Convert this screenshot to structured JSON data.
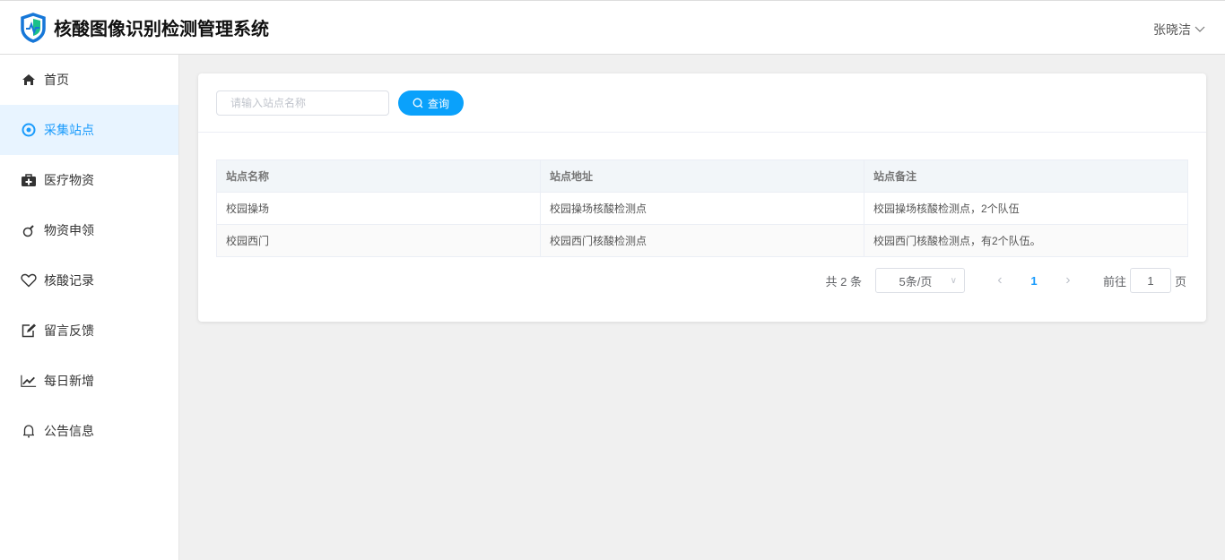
{
  "app": {
    "title": "核酸图像识别检测管理系统",
    "user": "张晓洁"
  },
  "sidebar": {
    "items": [
      {
        "label": "首页",
        "icon": "home-icon"
      },
      {
        "label": "采集站点",
        "icon": "target-icon",
        "active": true
      },
      {
        "label": "医疗物资",
        "icon": "medkit-icon"
      },
      {
        "label": "物资申领",
        "icon": "bomb-icon"
      },
      {
        "label": "核酸记录",
        "icon": "heart-icon"
      },
      {
        "label": "留言反馈",
        "icon": "edit-icon"
      },
      {
        "label": "每日新增",
        "icon": "line-chart-icon"
      },
      {
        "label": "公告信息",
        "icon": "bell-icon"
      }
    ]
  },
  "search": {
    "placeholder": "请输入站点名称",
    "button": "查询"
  },
  "table": {
    "headers": [
      "站点名称",
      "站点地址",
      "站点备注"
    ],
    "rows": [
      [
        "校园操场",
        "校园操场核酸检测点",
        "校园操场核酸检测点，2个队伍"
      ],
      [
        "校园西门",
        "校园西门核酸检测点",
        "校园西门核酸检测点，有2个队伍。"
      ]
    ]
  },
  "pagination": {
    "total": "共 2 条",
    "page_size": "5条/页",
    "current": "1",
    "goto_label": "前往",
    "goto_value": "1",
    "page_suffix": "页"
  },
  "colors": {
    "accent": "#0aa1fb",
    "active_bg": "#e8f4ff"
  }
}
